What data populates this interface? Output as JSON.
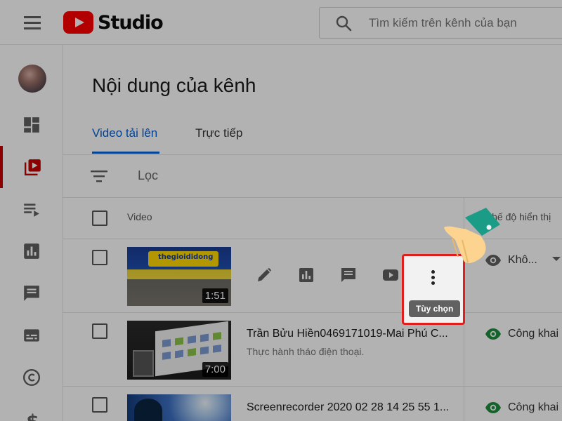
{
  "header": {
    "logo_text": "Studio",
    "search_placeholder": "Tìm kiếm trên kênh của bạn"
  },
  "sidebar": {
    "items": [
      {
        "icon": "dashboard-icon"
      },
      {
        "icon": "content-icon",
        "active": true
      },
      {
        "icon": "playlists-icon"
      },
      {
        "icon": "analytics-icon"
      },
      {
        "icon": "comments-icon"
      },
      {
        "icon": "subtitles-icon"
      },
      {
        "icon": "copyright-icon"
      },
      {
        "icon": "monetization-icon"
      }
    ]
  },
  "page": {
    "title": "Nội dung của kênh",
    "tabs": [
      {
        "label": "Video tải lên",
        "active": true
      },
      {
        "label": "Trực tiếp",
        "active": false
      }
    ],
    "filter_label": "Lọc"
  },
  "table": {
    "columns": {
      "video": "Video",
      "visibility": "Chế độ hiển thị"
    },
    "rows": [
      {
        "title": "",
        "description": "",
        "duration": "1:51",
        "visibility": "Khô...",
        "thumb_text": "thegioididong"
      },
      {
        "title": "Trần Bửu Hiền0469171019-Mai Phú C...",
        "description": "Thực hành tháo điện thoại.",
        "duration": "7:00",
        "visibility": "Công khai"
      },
      {
        "title": "Screenrecorder 2020 02 28 14 25 55 1...",
        "description": "",
        "duration": "",
        "visibility": "Công khai"
      }
    ]
  },
  "options_menu": {
    "tooltip": "Tùy chọn"
  },
  "colors": {
    "accent_blue": "#065fd4",
    "brand_red": "#ff0000",
    "active_red": "#cc0000",
    "public_green": "#1e8e3e",
    "highlight_red": "#e01e1e"
  }
}
